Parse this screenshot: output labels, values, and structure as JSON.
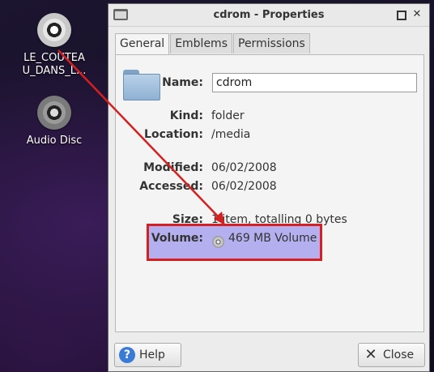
{
  "desktop": {
    "icons": [
      {
        "label": "LE_COUTEA\nU_DANS_L..."
      },
      {
        "label": "Audio Disc"
      }
    ]
  },
  "window": {
    "title": "cdrom - Properties",
    "tabs": [
      "General",
      "Emblems",
      "Permissions"
    ],
    "general": {
      "name_label": "Name:",
      "name_value": "cdrom",
      "kind_label": "Kind:",
      "kind_value": "folder",
      "location_label": "Location:",
      "location_value": "/media",
      "modified_label": "Modified:",
      "modified_value": "06/02/2008",
      "accessed_label": "Accessed:",
      "accessed_value": "06/02/2008",
      "size_label": "Size:",
      "size_value": "1 item, totalling 0 bytes",
      "volume_label": "Volume:",
      "volume_value": "469 MB Volume"
    },
    "buttons": {
      "help": "Help",
      "close": "Close"
    }
  },
  "annotation": {
    "highlight_color": "#d42020"
  }
}
